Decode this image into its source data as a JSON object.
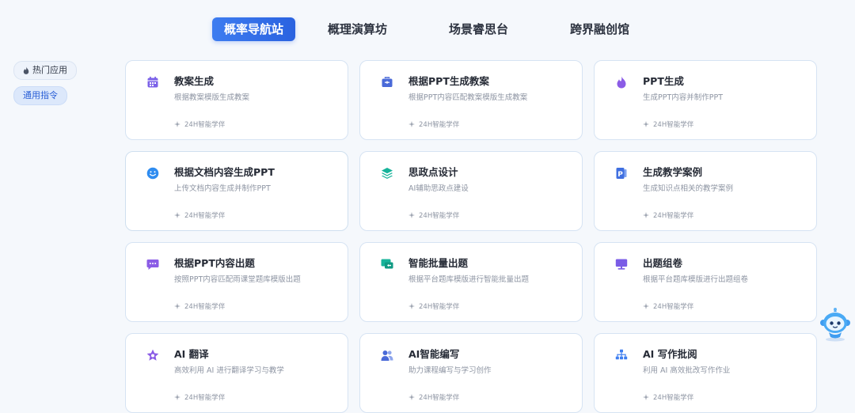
{
  "nav": {
    "tabs": [
      {
        "label": "概率导航站",
        "active": true
      },
      {
        "label": "概理演算坊",
        "active": false
      },
      {
        "label": "场景睿思台",
        "active": false
      },
      {
        "label": "跨界融创馆",
        "active": false
      }
    ]
  },
  "sidebar": {
    "hot_label": "热门应用",
    "general_label": "通用指令"
  },
  "cards": [
    {
      "title": "教案生成",
      "desc": "根据教案模版生成教案",
      "meta": "24H智能学伴",
      "icon": "calendar-icon",
      "color": "#7b61e8"
    },
    {
      "title": "根据PPT生成教案",
      "desc": "根据PPT内容匹配教案模版生成教案",
      "meta": "24H智能学伴",
      "icon": "briefcase-icon",
      "color": "#4a6ad8"
    },
    {
      "title": "PPT生成",
      "desc": "生成PPT内容并制作PPT",
      "meta": "24H智能学伴",
      "icon": "flame-icon",
      "color": "#8b5ce6"
    },
    {
      "title": "根据文档内容生成PPT",
      "desc": "上传文档内容生成并制作PPT",
      "meta": "24H智能学伴",
      "icon": "smile-icon",
      "color": "#2f8cf0"
    },
    {
      "title": "思政点设计",
      "desc": "AI辅助思政点建设",
      "meta": "24H智能学伴",
      "icon": "layers-icon",
      "color": "#16b39a"
    },
    {
      "title": "生成教学案例",
      "desc": "生成知识点相关的教学案例",
      "meta": "24H智能学伴",
      "icon": "ppt-file-icon",
      "color": "#3f6fe0"
    },
    {
      "title": "根据PPT内容出题",
      "desc": "按照PPT内容匹配雨课堂题库模版出题",
      "meta": "24H智能学伴",
      "icon": "chat-icon",
      "color": "#8b5ce6"
    },
    {
      "title": "智能批量出题",
      "desc": "根据平台题库模版进行智能批量出题",
      "meta": "24H智能学伴",
      "icon": "reply-icon",
      "color": "#16b39a"
    },
    {
      "title": "出题组卷",
      "desc": "根据平台题库模版进行出题组卷",
      "meta": "24H智能学伴",
      "icon": "monitor-icon",
      "color": "#7a5ce6"
    },
    {
      "title": "AI 翻译",
      "desc": "高效利用 AI 进行翻译学习与教学",
      "meta": "24H智能学伴",
      "icon": "star-icon",
      "color": "#8b5ce6"
    },
    {
      "title": "AI智能编写",
      "desc": "助力课程编写与学习创作",
      "meta": "24H智能学伴",
      "icon": "users-icon",
      "color": "#4a6ad8"
    },
    {
      "title": "AI 写作批阅",
      "desc": "利用 AI 高效批改写作作业",
      "meta": "24H智能学伴",
      "icon": "sitemap-icon",
      "color": "#3f7ff0"
    }
  ]
}
